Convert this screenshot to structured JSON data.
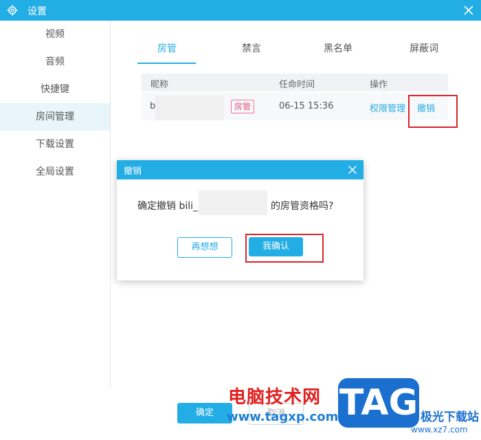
{
  "window": {
    "title": "设置"
  },
  "sidebar": {
    "items": [
      {
        "label": "视频"
      },
      {
        "label": "音频"
      },
      {
        "label": "快捷键"
      },
      {
        "label": "房间管理"
      },
      {
        "label": "下载设置"
      },
      {
        "label": "全局设置"
      }
    ],
    "active_index": 3
  },
  "tabs": [
    {
      "label": "房管"
    },
    {
      "label": "禁言"
    },
    {
      "label": "黑名单"
    },
    {
      "label": "屏蔽词"
    }
  ],
  "table": {
    "headers": {
      "nickname": "昵称",
      "time": "任命时间",
      "action": "操作"
    },
    "rows": [
      {
        "nickname": "b",
        "badge": "房管",
        "time": "06-15 15:36",
        "permission_link": "权限管理",
        "revoke_link": "撤销"
      }
    ]
  },
  "dialog": {
    "title": "撤销",
    "message_prefix": "确定撤销 bili_",
    "message_suffix": "的房管资格吗?",
    "cancel_label": "再想想",
    "confirm_label": "我确认"
  },
  "footer": {
    "ok_label": "确定",
    "cancel_label": "取消"
  },
  "watermark": {
    "site_name": "电脑技术网",
    "site_url": "www.tagxp.com",
    "logo_text": "TAG",
    "logo_sub": "极光下载站",
    "logo_url": "www.xz7.com"
  },
  "colors": {
    "accent": "#23ade5",
    "highlight_box": "#d9232d",
    "badge": "#e0577d"
  }
}
